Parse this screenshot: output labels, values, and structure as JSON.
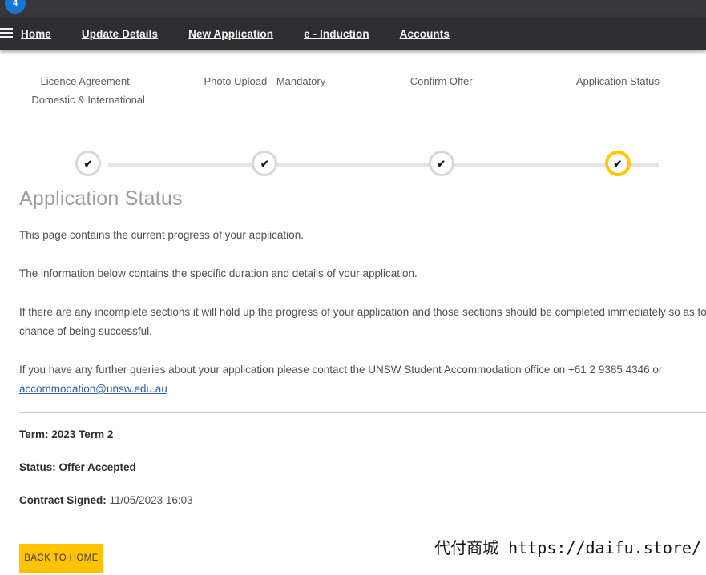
{
  "theme": {
    "top_strip_color": "#36363B",
    "navbar_color": "#2E2E30",
    "accent_gold": "#FFC300",
    "active_step_ring": "#FFC800",
    "badge_blue": "#1877D2",
    "link_blue": "#2C5FA8",
    "title_gray": "#9C9C9C"
  },
  "topbar": {
    "notification_count": "4",
    "menu_icon": "hamburger-menu-icon"
  },
  "nav": {
    "items": [
      {
        "label": "Home"
      },
      {
        "label": "Update Details"
      },
      {
        "label": "New Application"
      },
      {
        "label": "e - Induction"
      },
      {
        "label": "Accounts"
      }
    ]
  },
  "stepper": {
    "steps": [
      {
        "label": "Licence Agreement - Domestic & International",
        "state": "complete",
        "icon": "check-icon"
      },
      {
        "label": "Photo Upload - Mandatory",
        "state": "complete",
        "icon": "check-icon"
      },
      {
        "label": "Confirm Offer",
        "state": "complete",
        "icon": "check-icon"
      },
      {
        "label": "Application Status",
        "state": "active",
        "icon": "check-icon"
      }
    ],
    "check_glyph": "✔"
  },
  "main": {
    "title": "Application Status",
    "paragraphs": {
      "p1": "This page contains the current progress of your application.",
      "p2": "The information below contains the specific duration and details of your application.",
      "p3": "If there are any incomplete sections it will hold up the progress of your application and those sections should be completed immediately so as to give yourself the best chance of being successful.",
      "p4_before_link": "If you have any further queries about your application please contact the UNSW Student Accommodation office on +61 2 9385 4346 or",
      "contact_phone": "+61 2 9385 4346",
      "email_link": "accommodation@unsw.edu.au"
    },
    "details": [
      {
        "label": "Term:",
        "value": "2023 Term 2",
        "value_bold": true
      },
      {
        "label": "Status:",
        "value": "Offer Accepted",
        "value_bold": true
      },
      {
        "label": "Contract Signed:",
        "value": "11/05/2023 16:03",
        "value_bold": false
      }
    ],
    "back_button": "BACK TO HOME"
  },
  "watermark": {
    "text": "代付商城 https://daifu.store/"
  }
}
